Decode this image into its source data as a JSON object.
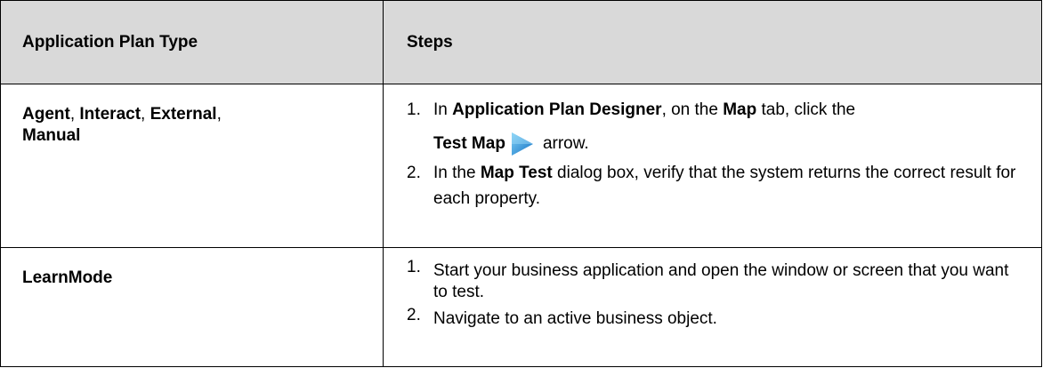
{
  "table": {
    "headers": [
      "Application Plan Type",
      "Steps"
    ],
    "rows": [
      {
        "type_parts": [
          {
            "text": "Agent",
            "bold": true
          },
          {
            "text": ", "
          },
          {
            "text": "Interact",
            "bold": true
          },
          {
            "text": ", "
          },
          {
            "text": "External",
            "bold": true
          },
          {
            "text": ","
          },
          {
            "text": "Manual",
            "bold": true
          }
        ],
        "steps": [
          {
            "num": "1.",
            "segments": [
              "In ",
              "Application Plan Designer",
              ", on the ",
              "Map",
              " tab, click the",
              "Test Map",
              "arrow."
            ],
            "icon": "blue-play-arrow-icon"
          },
          {
            "num": "2.",
            "segments": [
              "In the ",
              "Map Test",
              " dialog box, verify that the system returns the correct result for each property."
            ]
          }
        ]
      },
      {
        "type_parts": [
          {
            "text": "LearnMode",
            "bold": true
          }
        ],
        "steps": [
          {
            "num": "1.",
            "text": "Start your business application and open the window or screen that you want to test."
          },
          {
            "num": "2.",
            "text": "Navigate to an active business object."
          }
        ]
      }
    ]
  },
  "colors": {
    "header_bg": "#d9d9d9",
    "border": "#000000",
    "icon_light": "#6cc0f0",
    "icon_dark": "#1a7ac8"
  }
}
